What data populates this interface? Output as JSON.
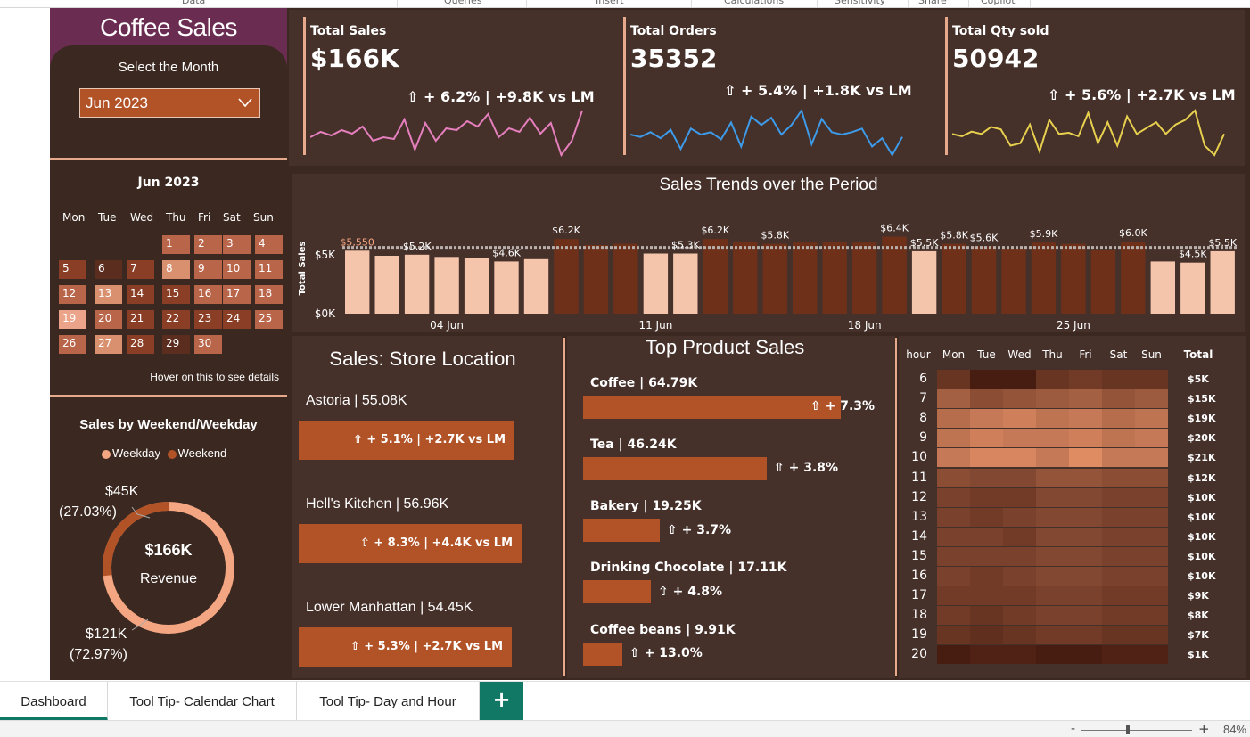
{
  "ribbon": [
    "Data",
    "Queries",
    "Insert",
    "Calculations",
    "Sensitivity",
    "Share",
    "Copilot"
  ],
  "colors": {
    "bg": "#3b2820",
    "panel": "#45302a",
    "accent": "#b25227",
    "light": "#f4c4ab",
    "sales_line": "#e57fbd",
    "orders_line": "#3d9be9",
    "qty_line": "#e8d04f",
    "title_bg": "#6b2c52"
  },
  "sidebar": {
    "title": "Coffee Sales",
    "select_label": "Select the Month",
    "selected_month": "Jun 2023",
    "calendar_title": "Jun 2023",
    "weekdays": [
      "Mon",
      "Tue",
      "Wed",
      "Thu",
      "Fri",
      "Sat",
      "Sun"
    ],
    "hover_note": "Hover on this to see details",
    "weekend_title": "Sales by Weekend/Weekday",
    "legend": [
      {
        "label": "Weekday",
        "color": "#f4a682"
      },
      {
        "label": "Weekend",
        "color": "#b25227"
      }
    ],
    "donut": {
      "center_value": "$166K",
      "center_label": "Revenue",
      "weekend_value": "$45K",
      "weekend_pct": "(27.03%)",
      "weekday_value": "$121K",
      "weekday_pct": "(72.97%)",
      "weekend_share": 0.2703
    }
  },
  "calendar_days": [
    {
      "d": "1",
      "s": 2
    },
    {
      "d": "2",
      "s": 2
    },
    {
      "d": "3",
      "s": 2
    },
    {
      "d": "4",
      "s": 2
    },
    {
      "d": "5",
      "s": 1
    },
    {
      "d": "6",
      "s": 0
    },
    {
      "d": "7",
      "s": 1
    },
    {
      "d": "8",
      "s": 3
    },
    {
      "d": "9",
      "s": 2
    },
    {
      "d": "10",
      "s": 2
    },
    {
      "d": "11",
      "s": 2
    },
    {
      "d": "12",
      "s": 2
    },
    {
      "d": "13",
      "s": 3
    },
    {
      "d": "14",
      "s": 1
    },
    {
      "d": "15",
      "s": 1
    },
    {
      "d": "16",
      "s": 2
    },
    {
      "d": "17",
      "s": 2
    },
    {
      "d": "18",
      "s": 2
    },
    {
      "d": "19",
      "s": 4
    },
    {
      "d": "20",
      "s": 2
    },
    {
      "d": "21",
      "s": 1
    },
    {
      "d": "22",
      "s": 1
    },
    {
      "d": "23",
      "s": 1
    },
    {
      "d": "24",
      "s": 1
    },
    {
      "d": "25",
      "s": 2
    },
    {
      "d": "26",
      "s": 2
    },
    {
      "d": "27",
      "s": 3
    },
    {
      "d": "28",
      "s": 1
    },
    {
      "d": "29",
      "s": 0
    },
    {
      "d": "30",
      "s": 2
    }
  ],
  "kpis": [
    {
      "label": "Total Sales",
      "value": "$166K",
      "delta": "⇧ + 6.2% | +9.8K vs LM",
      "series": [
        152,
        155,
        153,
        156,
        154,
        158,
        150,
        152,
        151,
        162,
        145,
        160,
        150,
        157,
        156,
        161,
        158,
        165,
        152,
        157,
        155,
        163,
        154,
        160,
        142,
        150,
        167
      ]
    },
    {
      "label": "Total Orders",
      "value": "35352",
      "delta": "⇧ + 5.4% | +1.8K vs LM",
      "series": [
        150,
        148,
        152,
        147,
        154,
        138,
        155,
        150,
        152,
        146,
        160,
        140,
        165,
        158,
        164,
        150,
        158,
        170,
        142,
        163,
        152,
        150,
        152,
        155,
        140,
        147,
        133,
        148
      ]
    },
    {
      "label": "Total Qty sold",
      "value": "50942",
      "delta": "⇧ + 5.6% | +2.7K vs LM",
      "series": [
        150,
        148,
        152,
        150,
        156,
        154,
        140,
        142,
        158,
        135,
        162,
        150,
        151,
        148,
        168,
        142,
        160,
        140,
        165,
        150,
        155,
        160,
        150,
        158,
        162,
        170,
        140,
        132,
        150
      ]
    }
  ],
  "trend": {
    "title": "Sales Trends over the Period",
    "ylabel": "Total Sales",
    "yticks": [
      "$5K",
      "$0K"
    ],
    "xticks": [
      "04 Jun",
      "11 Jun",
      "18 Jun",
      "25 Jun"
    ],
    "values": [
      5.55,
      5.1,
      5.2,
      5.0,
      4.9,
      4.6,
      4.8,
      6.2,
      5.7,
      5.8,
      5.3,
      5.3,
      6.2,
      6.0,
      5.8,
      5.9,
      6.0,
      5.9,
      6.4,
      5.5,
      5.8,
      5.6,
      5.4,
      5.9,
      5.8,
      5.3,
      6.0,
      4.6,
      4.5,
      5.5
    ],
    "weekend": [
      0,
      0,
      0,
      0,
      0,
      0,
      0,
      1,
      1,
      1,
      0,
      0,
      1,
      1,
      1,
      1,
      1,
      1,
      1,
      0,
      1,
      1,
      1,
      1,
      1,
      1,
      1,
      0,
      0,
      0
    ],
    "labels": [
      {
        "i": 0,
        "t": "$5,550"
      },
      {
        "i": 2,
        "t": "$5.2K"
      },
      {
        "i": 5,
        "t": "$4.6K"
      },
      {
        "i": 7,
        "t": "$6.2K"
      },
      {
        "i": 11,
        "t": "$5.3K"
      },
      {
        "i": 12,
        "t": "$6.2K"
      },
      {
        "i": 14,
        "t": "$5.8K"
      },
      {
        "i": 18,
        "t": "$6.4K"
      },
      {
        "i": 19,
        "t": "$5.5K"
      },
      {
        "i": 20,
        "t": "$5.8K"
      },
      {
        "i": 21,
        "t": "$5.6K"
      },
      {
        "i": 23,
        "t": "$5.9K"
      },
      {
        "i": 26,
        "t": "$6.0K"
      },
      {
        "i": 28,
        "t": "$4.5K"
      },
      {
        "i": 29,
        "t": "$5.5K"
      }
    ],
    "avg": 5.5
  },
  "stores": {
    "title": "Sales: Store Location",
    "items": [
      {
        "name": "Astoria | 55.08K",
        "delta": "⇧ + 5.1% | +2.7K vs LM",
        "value": 55.08
      },
      {
        "name": "Hell's Kitchen | 56.96K",
        "delta": "⇧ + 8.3% | +4.4K vs LM",
        "value": 56.96
      },
      {
        "name": "Lower Manhattan | 54.45K",
        "delta": "⇧ + 5.3% | +2.7K vs LM",
        "value": 54.45
      }
    ]
  },
  "products": {
    "title": "Top Product Sales",
    "items": [
      {
        "name": "Coffee | 64.79K",
        "delta": "⇧ + 7.3%",
        "value": 64.79
      },
      {
        "name": "Tea | 46.24K",
        "delta": "⇧ + 3.8%",
        "value": 46.24
      },
      {
        "name": "Bakery | 19.25K",
        "delta": "⇧ + 3.7%",
        "value": 19.25
      },
      {
        "name": "Drinking Chocolate | 17.11K",
        "delta": "⇧ + 4.8%",
        "value": 17.11
      },
      {
        "name": "Coffee beans | 9.91K",
        "delta": "⇧ + 13.0%",
        "value": 9.91
      }
    ]
  },
  "heatmap": {
    "hour_label": "hour",
    "days": [
      "Mon",
      "Tue",
      "Wed",
      "Thu",
      "Fri",
      "Sat",
      "Sun"
    ],
    "total_label": "Total",
    "hours": [
      "6",
      "7",
      "8",
      "9",
      "10",
      "11",
      "12",
      "13",
      "14",
      "15",
      "16",
      "17",
      "18",
      "19",
      "20"
    ],
    "totals": [
      "$5K",
      "$15K",
      "$19K",
      "$20K",
      "$21K",
      "$12K",
      "$10K",
      "$10K",
      "$10K",
      "$10K",
      "$10K",
      "$9K",
      "$8K",
      "$7K",
      "$1K"
    ],
    "values": [
      [
        0.25,
        0.05,
        0.05,
        0.25,
        0.3,
        0.25,
        0.25
      ],
      [
        0.6,
        0.45,
        0.5,
        0.55,
        0.6,
        0.5,
        0.55
      ],
      [
        0.7,
        0.8,
        0.85,
        0.75,
        0.8,
        0.7,
        0.75
      ],
      [
        0.75,
        0.85,
        0.8,
        0.8,
        0.85,
        0.75,
        0.8
      ],
      [
        0.8,
        0.9,
        0.9,
        0.8,
        0.95,
        0.8,
        0.8
      ],
      [
        0.45,
        0.4,
        0.4,
        0.5,
        0.5,
        0.45,
        0.45
      ],
      [
        0.35,
        0.3,
        0.3,
        0.4,
        0.4,
        0.35,
        0.35
      ],
      [
        0.35,
        0.3,
        0.35,
        0.4,
        0.4,
        0.35,
        0.35
      ],
      [
        0.35,
        0.35,
        0.3,
        0.4,
        0.4,
        0.35,
        0.35
      ],
      [
        0.35,
        0.35,
        0.35,
        0.4,
        0.4,
        0.35,
        0.35
      ],
      [
        0.35,
        0.3,
        0.35,
        0.4,
        0.4,
        0.35,
        0.35
      ],
      [
        0.3,
        0.3,
        0.3,
        0.35,
        0.35,
        0.3,
        0.3
      ],
      [
        0.3,
        0.25,
        0.3,
        0.35,
        0.35,
        0.3,
        0.3
      ],
      [
        0.25,
        0.2,
        0.25,
        0.3,
        0.3,
        0.25,
        0.25
      ],
      [
        0.05,
        0.1,
        0.1,
        0.05,
        0.05,
        0.1,
        0.1
      ]
    ]
  },
  "tabs": [
    "Dashboard",
    "Tool Tip- Calendar Chart",
    "Tool Tip- Day and Hour"
  ],
  "add_tab": "+",
  "zoom": {
    "minus": "-",
    "plus": "+",
    "level": "84%"
  }
}
